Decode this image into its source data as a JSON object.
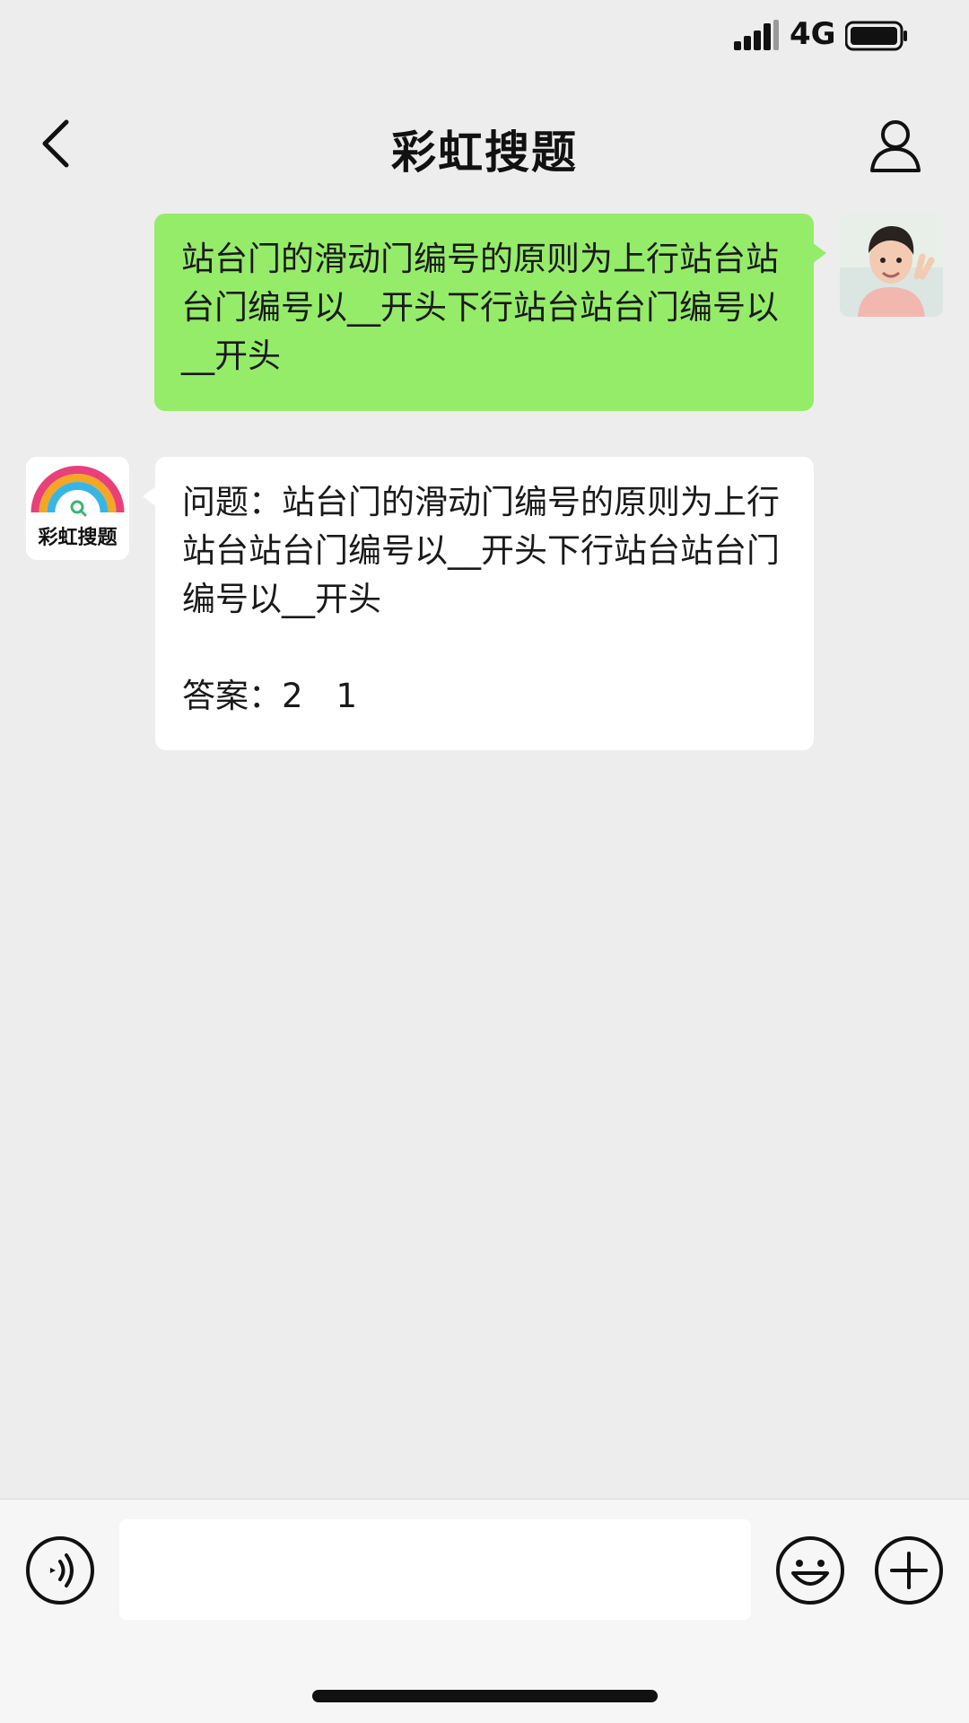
{
  "status_bar": {
    "network": "4G",
    "signal_icon": "signal-bars-icon",
    "battery_icon": "battery-icon"
  },
  "header": {
    "title": "彩虹搜题",
    "back_icon": "chevron-left-icon",
    "profile_icon": "person-icon"
  },
  "messages": [
    {
      "sender": "user",
      "text": "站台门的滑动门编号的原则为上行站台站台门编号以__开头下行站台站台门编号以__开头"
    },
    {
      "sender": "bot",
      "bot_name": "彩虹搜题",
      "question_label": "问题：站台门的滑动门编号的原则为上行站台站台门编号以__开头下行站台站台门编号以__开头",
      "answer_label": "答案：2　1"
    }
  ],
  "input_bar": {
    "value": "",
    "voice_icon": "voice-icon",
    "emoji_icon": "emoji-icon",
    "plus_icon": "plus-icon"
  },
  "colors": {
    "background": "#ededed",
    "sent_bubble": "#95ec69",
    "received_bubble": "#ffffff",
    "input_bar": "#f6f6f6"
  }
}
